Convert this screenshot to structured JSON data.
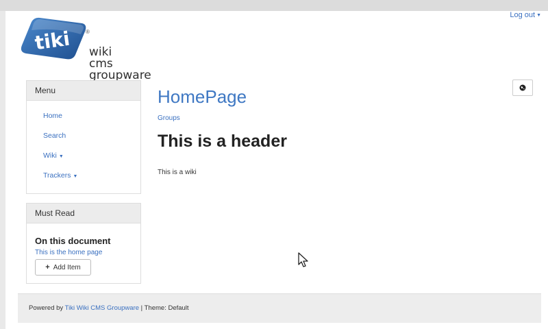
{
  "header": {
    "logout_label": "Log out"
  },
  "logo": {
    "badge_text": "tiki",
    "text_lines": [
      "wiki",
      "cms",
      "groupware"
    ],
    "registered_mark": "®"
  },
  "menu_module": {
    "title": "Menu",
    "items": [
      {
        "label": "Home",
        "has_dropdown": false
      },
      {
        "label": "Search",
        "has_dropdown": false
      },
      {
        "label": "Wiki",
        "has_dropdown": true
      },
      {
        "label": "Trackers",
        "has_dropdown": true
      }
    ]
  },
  "must_read_module": {
    "title": "Must Read",
    "section_title": "On this document",
    "link_text": "This is the home page",
    "add_button_label": "Add Item"
  },
  "main": {
    "page_title": "HomePage",
    "category_link": "Groups",
    "heading": "This is a header",
    "body_text": "This is a wiki"
  },
  "footer": {
    "prefix": "Powered by",
    "link_text": "Tiki Wiki CMS Groupware",
    "separator": "|",
    "theme_text": "Theme: Default"
  },
  "colors": {
    "link": "#3a70c0",
    "title": "#3f78c3",
    "logo_badge": "#2e5fa3"
  },
  "icons": {
    "language": "globe-icon",
    "add": "plus-icon",
    "dropdown": "caret-down-icon",
    "pointer": "mouse-pointer-icon"
  }
}
